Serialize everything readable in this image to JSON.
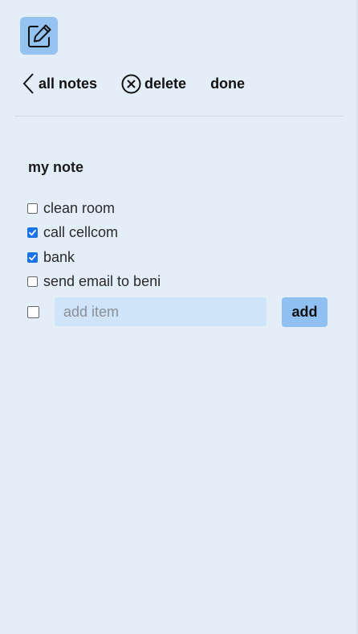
{
  "app": {
    "icon": "edit-note-icon"
  },
  "toolbar": {
    "back_label": "all notes",
    "back_icon": "chevron-left-icon",
    "delete_label": "delete",
    "delete_icon": "circle-x-icon",
    "done_label": "done"
  },
  "note": {
    "title": "my note",
    "items": [
      {
        "label": "clean room",
        "checked": false
      },
      {
        "label": "call cellcom",
        "checked": true
      },
      {
        "label": "bank",
        "checked": true
      },
      {
        "label": "send email to beni",
        "checked": false
      }
    ]
  },
  "add_item": {
    "checked": false,
    "placeholder": "add item",
    "value": "",
    "button_label": "add"
  },
  "colors": {
    "background": "#e4eef9",
    "accent": "#94c3f2",
    "checkbox_checked": "#1a73e8",
    "input_background": "#cfe3f9"
  }
}
